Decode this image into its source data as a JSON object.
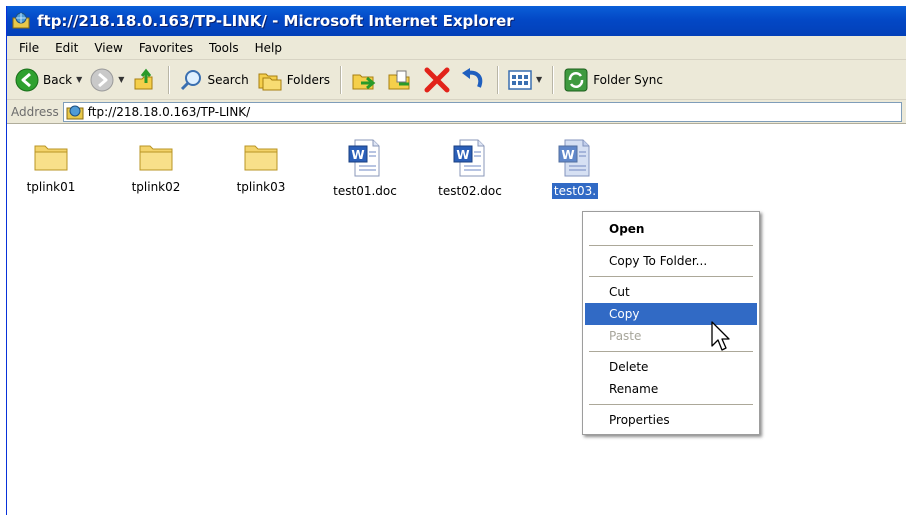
{
  "window": {
    "title": "ftp://218.18.0.163/TP-LINK/ - Microsoft Internet Explorer"
  },
  "menu": [
    "File",
    "Edit",
    "View",
    "Favorites",
    "Tools",
    "Help"
  ],
  "toolbar": {
    "back_label": "Back",
    "search_label": "Search",
    "folders_label": "Folders",
    "sync_label": "Folder Sync"
  },
  "address": {
    "label": "Address",
    "value": "ftp://218.18.0.163/TP-LINK/"
  },
  "files": [
    {
      "name": "tplink01",
      "type": "folder"
    },
    {
      "name": "tplink02",
      "type": "folder"
    },
    {
      "name": "tplink03",
      "type": "folder"
    },
    {
      "name": "test01.doc",
      "type": "doc"
    },
    {
      "name": "test02.doc",
      "type": "doc"
    },
    {
      "name": "test03.",
      "type": "doc",
      "selected": true
    }
  ],
  "context_menu": {
    "open": "Open",
    "copy_to_folder": "Copy To Folder...",
    "cut": "Cut",
    "copy": "Copy",
    "paste": "Paste",
    "delete": "Delete",
    "rename": "Rename",
    "properties": "Properties"
  },
  "colors": {
    "titlebar": "#0348c6",
    "selection": "#316ac5",
    "chrome": "#ece9d8"
  }
}
